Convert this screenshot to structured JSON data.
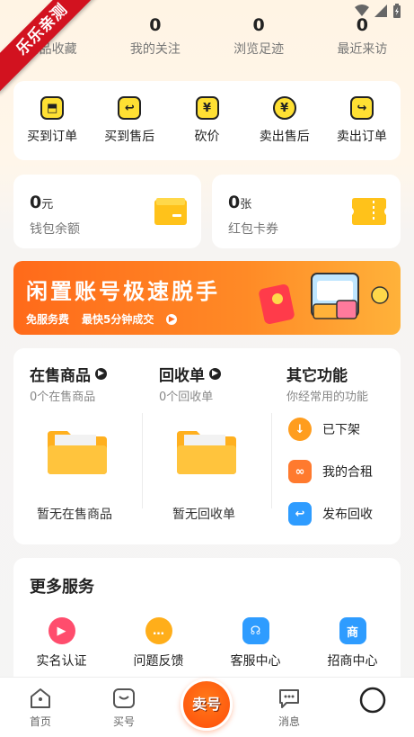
{
  "ribbon": "乐乐亲测",
  "stats": [
    {
      "num": "0",
      "label": "商品收藏"
    },
    {
      "num": "0",
      "label": "我的关注"
    },
    {
      "num": "0",
      "label": "浏览足迹"
    },
    {
      "num": "0",
      "label": "最近来访"
    }
  ],
  "orders": [
    {
      "label": "买到订单",
      "glyph": "⬒"
    },
    {
      "label": "买到售后",
      "glyph": "↩"
    },
    {
      "label": "砍价",
      "glyph": "¥"
    },
    {
      "label": "卖出售后",
      "glyph": "¥"
    },
    {
      "label": "卖出订单",
      "glyph": "↪"
    }
  ],
  "wallet": {
    "amount": "0",
    "unit": "元",
    "label": "钱包余额"
  },
  "coupon": {
    "amount": "0",
    "unit": "张",
    "label": "红包卡券"
  },
  "banner": {
    "title": "闲置账号极速脱手",
    "tag1": "免服务费",
    "tag2": "最快5分钟成交"
  },
  "on_sale": {
    "title": "在售商品",
    "count": "0个在售商品",
    "empty": "暂无在售商品"
  },
  "recycle": {
    "title": "回收单",
    "count": "0个回收单",
    "empty": "暂无回收单"
  },
  "other": {
    "title": "其它功能",
    "subtitle": "你经常用的功能",
    "items": [
      {
        "label": "已下架",
        "color": "#ff9d1e",
        "glyph": "↓"
      },
      {
        "label": "我的合租",
        "color": "#ff7a2e",
        "glyph": "∞"
      },
      {
        "label": "发布回收",
        "color": "#2e9cff",
        "glyph": "↩"
      }
    ]
  },
  "more": {
    "title": "更多服务",
    "items": [
      {
        "label": "实名认证",
        "color": "#ff4d6d",
        "glyph": "▶"
      },
      {
        "label": "问题反馈",
        "color": "#ffae1a",
        "glyph": "…"
      },
      {
        "label": "客服中心",
        "color": "#2e9cff",
        "glyph": "☊"
      },
      {
        "label": "招商中心",
        "color": "#2e9cff",
        "glyph": "商"
      }
    ]
  },
  "tabs": {
    "home": "首页",
    "buy": "买号",
    "sell": "卖号",
    "messages": "消息"
  }
}
